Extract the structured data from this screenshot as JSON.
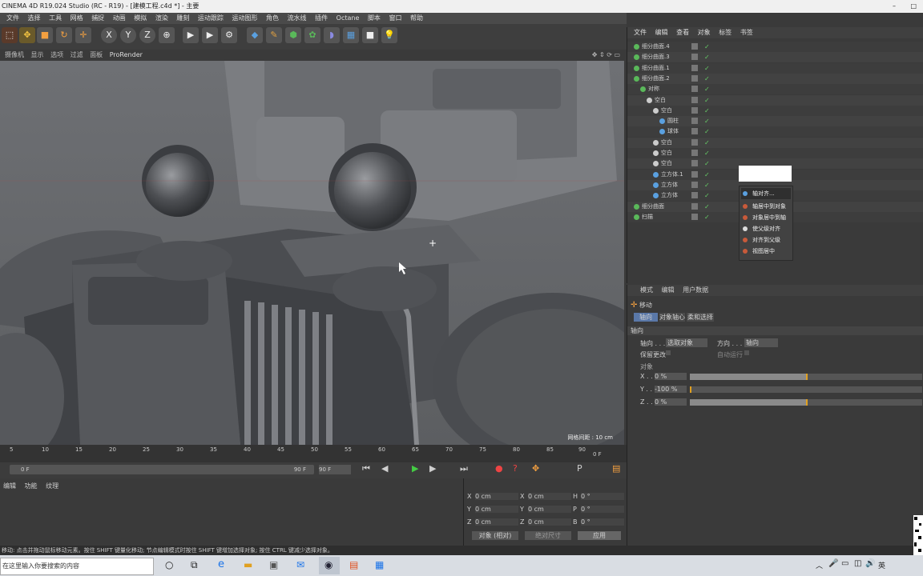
{
  "window": {
    "title": "CINEMA 4D R19.024 Studio (RC - R19) - [建模工程.c4d *] - 主要"
  },
  "menubar": [
    "文件",
    "选择",
    "工具",
    "网格",
    "捕捉",
    "动画",
    "模拟",
    "渲染",
    "雕刻",
    "运动跟踪",
    "运动图形",
    "角色",
    "流水线",
    "插件",
    "Octane",
    "脚本",
    "窗口",
    "帮助"
  ],
  "viewport_menu": [
    "摄像机",
    "显示",
    "选项",
    "过滤",
    "面板",
    "ProRender"
  ],
  "viewport_info": "网格间距 : 10 cm",
  "ruler_ticks": [
    "5",
    "10",
    "15",
    "20",
    "25",
    "30",
    "35",
    "40",
    "45",
    "50",
    "55",
    "60",
    "65",
    "70",
    "75",
    "80",
    "85",
    "90"
  ],
  "current_frame": "0 F",
  "timeline": {
    "start": "0 F",
    "end": "90 F",
    "max": "90 F"
  },
  "bottom_tabs": [
    "编辑",
    "功能",
    "纹理"
  ],
  "coords": {
    "rows": [
      {
        "axis": "X",
        "pos": "0 cm",
        "axis2": "X",
        "size": "0 cm",
        "axis3": "H",
        "rot": "0 °"
      },
      {
        "axis": "Y",
        "pos": "0 cm",
        "axis2": "Y",
        "size": "0 cm",
        "axis3": "P",
        "rot": "0 °"
      },
      {
        "axis": "Z",
        "pos": "0 cm",
        "axis2": "Z",
        "size": "0 cm",
        "axis3": "B",
        "rot": "0 °"
      }
    ],
    "mode": "对象 (相对)",
    "size_mode": "绝对尺寸",
    "apply": "应用"
  },
  "status_text": "移动: 点击并拖动鼠标移动元素。按住 SHIFT 键量化移动; 节点编辑模式时按住 SHIFT 键增加选择对象; 按住 CTRL 键减少选择对象。",
  "object_manager": {
    "tabs": [
      "文件",
      "编辑",
      "查看",
      "对象",
      "标签",
      "书签"
    ],
    "objects": [
      {
        "name": "细分曲面.4",
        "indent": 0,
        "color": "#5ab85a"
      },
      {
        "name": "细分曲面.3",
        "indent": 0,
        "color": "#5ab85a"
      },
      {
        "name": "细分曲面.1",
        "indent": 0,
        "color": "#5ab85a"
      },
      {
        "name": "细分曲面.2",
        "indent": 0,
        "color": "#5ab85a"
      },
      {
        "name": "对称",
        "indent": 1,
        "color": "#5ab85a"
      },
      {
        "name": "空白",
        "indent": 2,
        "color": "#cccccc"
      },
      {
        "name": "空白",
        "indent": 3,
        "color": "#cccccc"
      },
      {
        "name": "圆柱",
        "indent": 4,
        "color": "#5aa0e0"
      },
      {
        "name": "球体",
        "indent": 4,
        "color": "#5aa0e0"
      },
      {
        "name": "空白",
        "indent": 3,
        "color": "#cccccc"
      },
      {
        "name": "空白",
        "indent": 3,
        "color": "#cccccc"
      },
      {
        "name": "空白",
        "indent": 3,
        "color": "#cccccc"
      },
      {
        "name": "立方体.1",
        "indent": 3,
        "color": "#5aa0e0"
      },
      {
        "name": "立方体",
        "indent": 3,
        "color": "#5aa0e0"
      },
      {
        "name": "立方体",
        "indent": 3,
        "color": "#5aa0e0"
      },
      {
        "name": "细分曲面",
        "indent": 0,
        "color": "#5ab85a"
      },
      {
        "name": "扫描",
        "indent": 0,
        "color": "#5ab85a"
      }
    ]
  },
  "context_menu": [
    "轴对齐...",
    "轴居中到对象",
    "对象居中到轴",
    "使父级对齐",
    "对齐到父级",
    "视图居中"
  ],
  "attribute_manager": {
    "tabs": [
      "模式",
      "编辑",
      "用户数据"
    ],
    "tool": "移动",
    "subtabs": [
      "轴向",
      "对象轴心",
      "柔和选择"
    ],
    "section": "轴向",
    "axis_label": "轴向 . . . .",
    "axis_value": "选取对象",
    "dir_label": "方向 . . . .",
    "dir_value": "轴向",
    "keep_label": "保留更改",
    "auto_label": "自动运行",
    "group": "对象",
    "sliders": [
      {
        "axis": "X . . .",
        "value": "0 %",
        "fraction": 0.5
      },
      {
        "axis": "Y . . .",
        "value": "-100 %",
        "fraction": 0.0
      },
      {
        "axis": "Z . . .",
        "value": "0 %",
        "fraction": 0.5
      }
    ]
  },
  "taskbar": {
    "search": "在这里输入你要搜索的内容",
    "ime": "英"
  }
}
